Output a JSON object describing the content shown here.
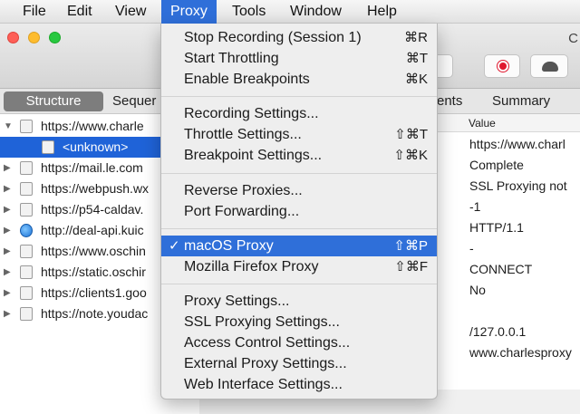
{
  "menubar": {
    "items": [
      "File",
      "Edit",
      "View",
      "Proxy",
      "Tools",
      "Window",
      "Help"
    ]
  },
  "window": {
    "title_partial": "C"
  },
  "tabs": {
    "structure": "Structure",
    "sequence": "Sequer",
    "contents": "ents",
    "summary": "Summary"
  },
  "tree": {
    "rows": [
      {
        "text": "https://www.charle"
      },
      {
        "text": "<unknown>"
      },
      {
        "text": "https://mail.le.com"
      },
      {
        "text": "https://webpush.wx"
      },
      {
        "text": "https://p54-caldav."
      },
      {
        "text": "http://deal-api.kuic"
      },
      {
        "text": "https://www.oschin"
      },
      {
        "text": "https://static.oschir"
      },
      {
        "text": "https://clients1.goo"
      },
      {
        "text": "https://note.youdac"
      }
    ]
  },
  "summary_panel": {
    "column_header": "Value",
    "values": [
      "https://www.charl",
      "Complete",
      "SSL Proxying not",
      "-1",
      "HTTP/1.1",
      "-",
      "CONNECT",
      "No",
      "",
      "/127.0.0.1",
      "www.charlesproxy"
    ]
  },
  "proxy_menu": {
    "group1": [
      {
        "label": "Stop Recording (Session 1)",
        "shortcut": "⌘R"
      },
      {
        "label": "Start Throttling",
        "shortcut": "⌘T"
      },
      {
        "label": "Enable Breakpoints",
        "shortcut": "⌘K"
      }
    ],
    "group2": [
      {
        "label": "Recording Settings...",
        "shortcut": ""
      },
      {
        "label": "Throttle Settings...",
        "shortcut": "⇧⌘T"
      },
      {
        "label": "Breakpoint Settings...",
        "shortcut": "⇧⌘K"
      }
    ],
    "group3": [
      {
        "label": "Reverse Proxies...",
        "shortcut": ""
      },
      {
        "label": "Port Forwarding...",
        "shortcut": ""
      }
    ],
    "group4": [
      {
        "label": "macOS Proxy",
        "shortcut": "⇧⌘P",
        "checkmark": "✓",
        "checked": true,
        "highlighted": true
      },
      {
        "label": "Mozilla Firefox Proxy",
        "shortcut": "⇧⌘F"
      }
    ],
    "group5": [
      {
        "label": "Proxy Settings...",
        "shortcut": ""
      },
      {
        "label": "SSL Proxying Settings...",
        "shortcut": ""
      },
      {
        "label": "Access Control Settings...",
        "shortcut": ""
      },
      {
        "label": "External Proxy Settings...",
        "shortcut": ""
      },
      {
        "label": "Web Interface Settings...",
        "shortcut": ""
      }
    ]
  },
  "colors": {
    "highlight": "#2f6fd9",
    "selection": "#1f63d8",
    "record_red": "#e0182f"
  }
}
